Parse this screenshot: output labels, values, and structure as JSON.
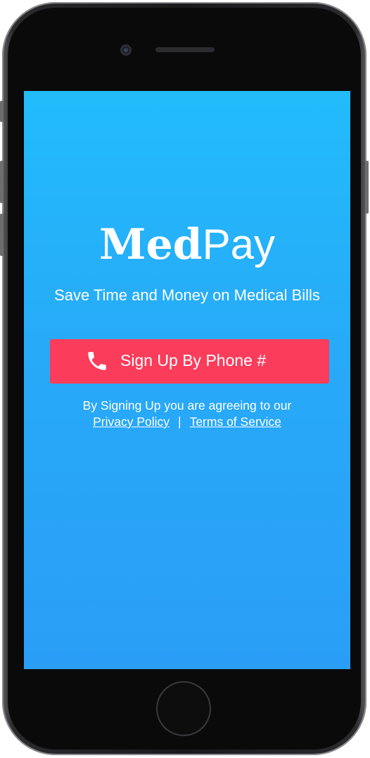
{
  "app": {
    "logo_bold": "Med",
    "logo_light": "Pay",
    "tagline": "Save Time and Money on Medical Bills"
  },
  "signup": {
    "label": "Sign Up By Phone #",
    "icon": "phone-icon"
  },
  "legal": {
    "agree_text": "By Signing Up you are agreeing to our",
    "privacy_label": "Privacy Policy",
    "separator": "|",
    "terms_label": "Terms of Service"
  },
  "colors": {
    "background_top": "#22bcfb",
    "background_bottom": "#2a9ef6",
    "signup_button": "#fb3c5a",
    "text": "#ffffff"
  }
}
